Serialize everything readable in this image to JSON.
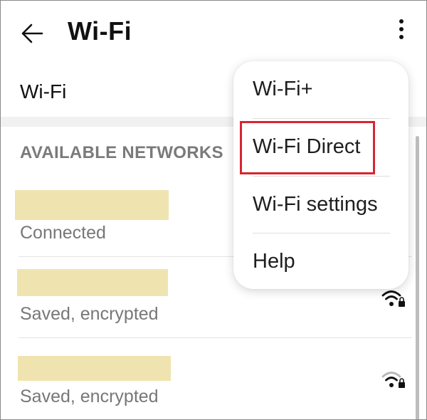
{
  "header": {
    "title": "Wi-Fi",
    "back_icon": "arrow-left-icon",
    "more_icon": "more-vertical-icon"
  },
  "wifi_toggle": {
    "label": "Wi-Fi"
  },
  "available_networks": {
    "header": "AVAILABLE NETWORKS",
    "items": [
      {
        "ssid": "",
        "status": "Connected",
        "signal_icon": null
      },
      {
        "ssid": "",
        "status": "Saved, encrypted",
        "signal_icon": "wifi-lock-icon",
        "signal_strength": "full"
      },
      {
        "ssid": "",
        "status": "Saved, encrypted",
        "signal_icon": "wifi-lock-icon",
        "signal_strength": "medium"
      }
    ]
  },
  "overflow_menu": {
    "items": [
      {
        "label": "Wi-Fi+"
      },
      {
        "label": "Wi-Fi Direct",
        "highlighted": true
      },
      {
        "label": "Wi-Fi settings"
      },
      {
        "label": "Help"
      }
    ]
  },
  "colors": {
    "highlight": "#d62630",
    "redaction": "#efe4b0",
    "section_header": "#7a7a7a"
  }
}
